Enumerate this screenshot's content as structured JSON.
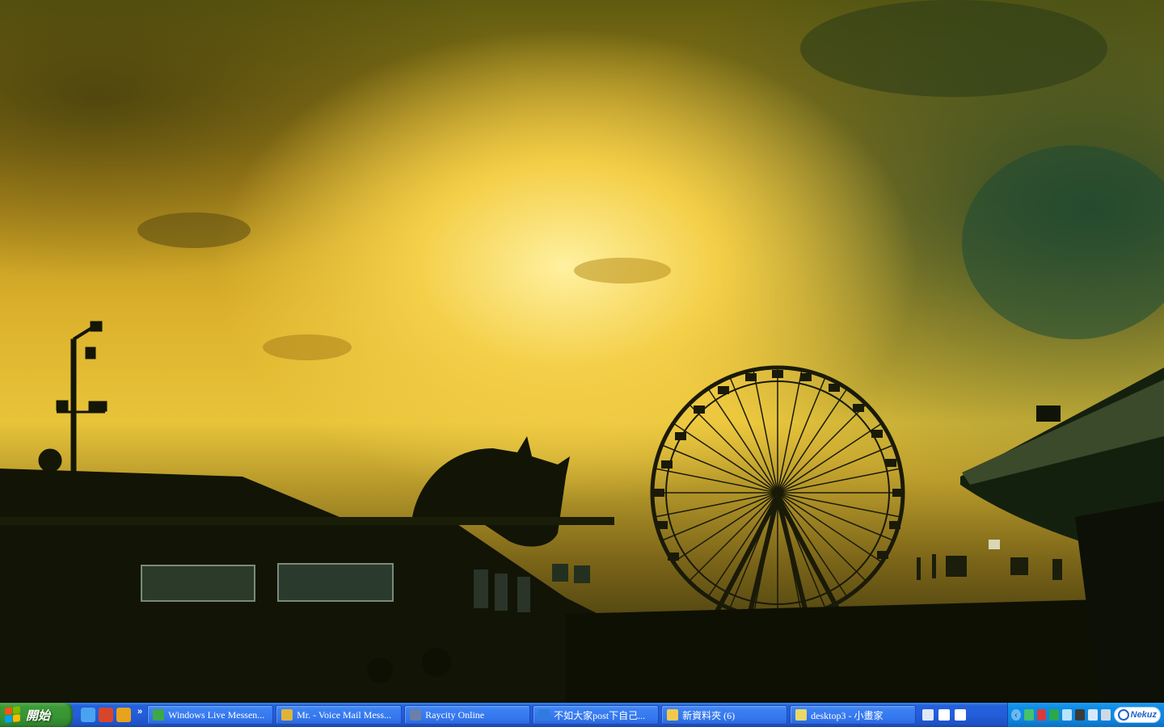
{
  "taskbar": {
    "start_label": "開始",
    "quick_launch": [
      {
        "icon": "show-desktop-icon",
        "color": "#4aa3f0"
      },
      {
        "icon": "browser-circle-icon",
        "color": "#d9452b"
      },
      {
        "icon": "messenger-buddy-icon",
        "color": "#e8a21c"
      }
    ],
    "overflow_chevron": "»",
    "tasks": [
      {
        "label": "Windows Live Messen...",
        "icon": "messenger-icon",
        "color": "#3da847"
      },
      {
        "label": "Mr. - Voice Mail Mess...",
        "icon": "voice-mail-icon",
        "color": "#e0b338"
      },
      {
        "label": "Raycity Online",
        "icon": "raycity-icon",
        "color": "#6b7fa8"
      },
      {
        "label": "不如大家post下自己...",
        "icon": "internet-explorer-icon",
        "color": "#2f7be0"
      },
      {
        "label": "新資料夾 (6)",
        "icon": "folder-icon",
        "color": "#f2c94c"
      },
      {
        "label": "desktop3 - 小畫家",
        "icon": "paint-icon",
        "color": "#e9d86a"
      }
    ],
    "tray_left_icons": [
      {
        "icon": "keyboard-icon",
        "color": "#dfe8f6"
      },
      {
        "icon": "help-icon",
        "color": "#ffffff"
      },
      {
        "icon": "input-method-icon",
        "color": "#ffffff"
      }
    ],
    "tray": {
      "expand_arrow": "‹",
      "icons": [
        {
          "icon": "network-icon",
          "color": "#45c26a"
        },
        {
          "icon": "shield-icon",
          "color": "#d93b3b"
        },
        {
          "icon": "antivirus-icon",
          "color": "#2aa84a"
        },
        {
          "icon": "sync-icon",
          "color": "#b7e3ff"
        },
        {
          "icon": "monitor-icon",
          "color": "#3a3a3a"
        },
        {
          "icon": "chart-icon",
          "color": "#d8e8f8"
        },
        {
          "icon": "speaker-icon",
          "color": "#cfd9e6"
        }
      ],
      "brand": "Nekuz"
    }
  }
}
